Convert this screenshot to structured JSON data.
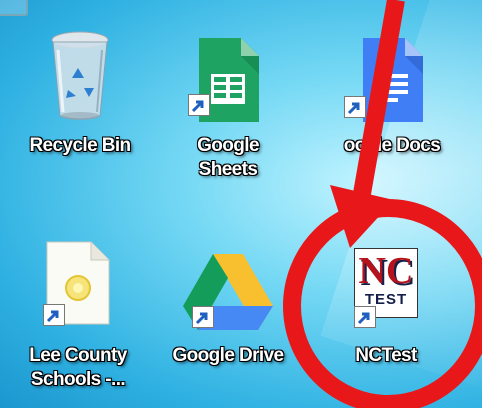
{
  "desktop": {
    "icons": [
      {
        "label": "Recycle Bin",
        "icon": "recycle-bin-icon"
      },
      {
        "label": "Google Sheets",
        "label_line1": "Google",
        "label_line2": "Sheets",
        "icon": "google-sheets-icon"
      },
      {
        "label": "oogle Docs",
        "icon": "google-docs-icon"
      },
      {
        "label_line1": "Lee County",
        "label_line2": "Schools -...",
        "icon": "document-icon"
      },
      {
        "label": "Google Drive",
        "icon": "google-drive-icon"
      },
      {
        "label": "NCTest",
        "icon": "nctest-icon"
      }
    ]
  },
  "nctest_logo": {
    "top": "NC",
    "bottom": "TEST"
  },
  "annotation": {
    "arrow_color": "#e8181a",
    "circle_color": "#e8181a"
  },
  "colors": {
    "sheets_green": "#1ea362",
    "docs_blue": "#3f7ef4",
    "drive_yellow": "#f8c02e",
    "drive_green": "#139c5a",
    "drive_blue": "#4688f4"
  }
}
